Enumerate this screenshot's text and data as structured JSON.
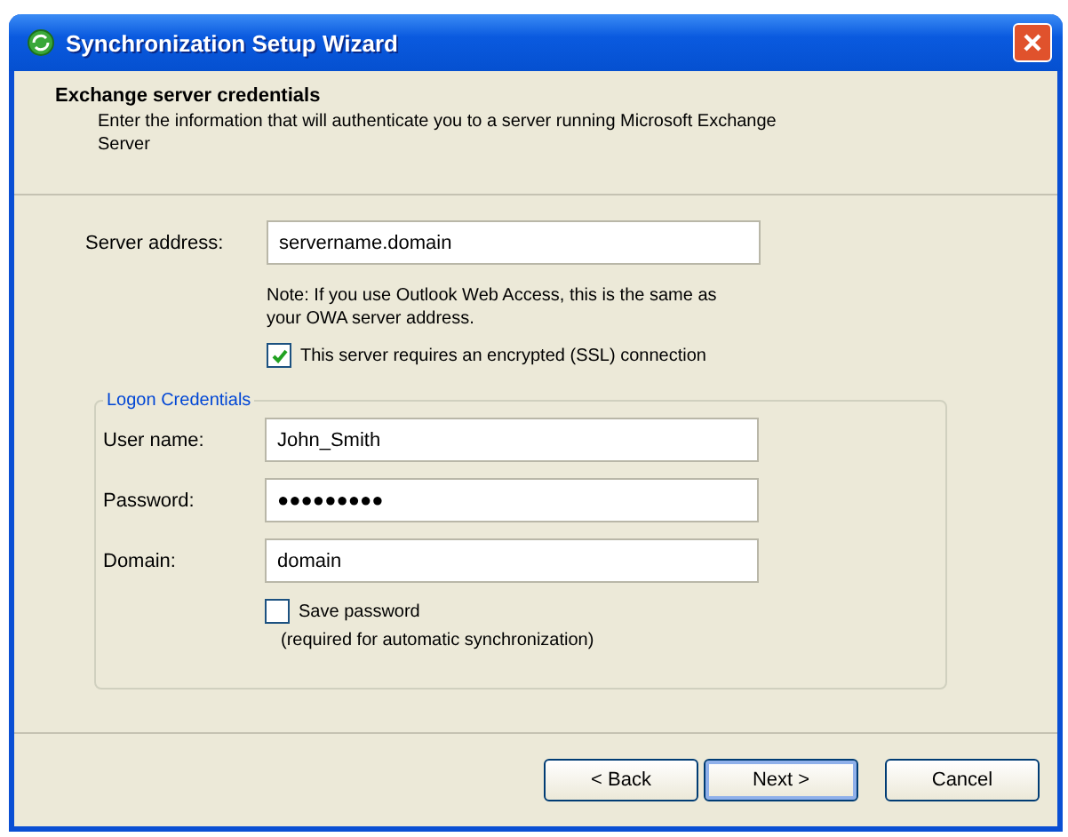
{
  "window": {
    "title": "Synchronization Setup Wizard"
  },
  "header": {
    "title": "Exchange server credentials",
    "description": "Enter the information that will authenticate you to a server running Microsoft Exchange Server"
  },
  "server": {
    "label": "Server address:",
    "value": "servername.domain",
    "note": "Note: If you use Outlook Web Access, this is the same as your OWA server address.",
    "ssl": {
      "label": "This server requires an encrypted (SSL) connection",
      "checked": true
    }
  },
  "logon": {
    "legend": "Logon Credentials",
    "fields": [
      {
        "label": "User name:",
        "value": "John_Smith"
      },
      {
        "label": "Password:",
        "value": "●●●●●●●●●"
      },
      {
        "label": "Domain:",
        "value": "domain"
      }
    ],
    "save_password": {
      "label": "Save password",
      "checked": false
    },
    "save_note": "(required for automatic synchronization)"
  },
  "buttons": [
    {
      "label": "< Back",
      "default": false
    },
    {
      "label": "Next >",
      "default": true
    },
    {
      "label": "Cancel",
      "default": false
    }
  ]
}
